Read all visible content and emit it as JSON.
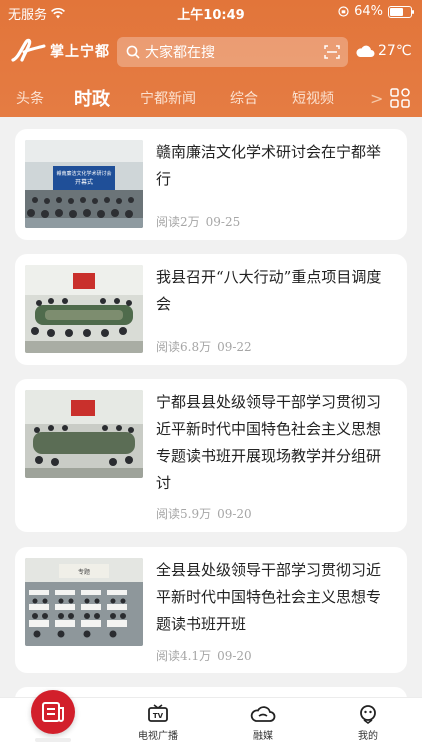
{
  "status_bar": {
    "carrier": "无服务",
    "time": "上午10:49",
    "battery_percent": "64%",
    "battery_level": 0.64
  },
  "header": {
    "app_name": "掌上宁都",
    "search_placeholder": "大家都在搜",
    "temperature": "27℃"
  },
  "tabs": [
    {
      "label": "头条",
      "active": false
    },
    {
      "label": "时政",
      "active": true
    },
    {
      "label": "宁都新闻",
      "active": false
    },
    {
      "label": "综合",
      "active": false
    },
    {
      "label": "短视频",
      "active": false
    }
  ],
  "tabs_more_label": ">",
  "articles": [
    {
      "title": "赣南廉洁文化学术研讨会在宁都举行",
      "reads": "阅读2万",
      "date": "09-25",
      "thumb_banner": "赣南廉洁文化学术研讨会\n开幕式"
    },
    {
      "title": "我县召开“八大行动”重点项目调度会",
      "reads": "阅读6.8万",
      "date": "09-22"
    },
    {
      "title": "宁都县县处级领导干部学习贯彻习近平新时代中国特色社会主义思想专题读书班开展现场教学并分组研讨",
      "reads": "阅读5.9万",
      "date": "09-20"
    },
    {
      "title": "全县县处级领导干部学习贯彻习近平新时代中国特色社会主义思想专题读书班开班",
      "reads": "阅读4.1万",
      "date": "09-20",
      "thumb_banner": "专题"
    }
  ],
  "bottom_nav": {
    "tv_label": "电视广播",
    "media_label": "融媒",
    "me_label": "我的"
  },
  "colors": {
    "header": "#e57c43",
    "home_button": "#d21f2b"
  }
}
